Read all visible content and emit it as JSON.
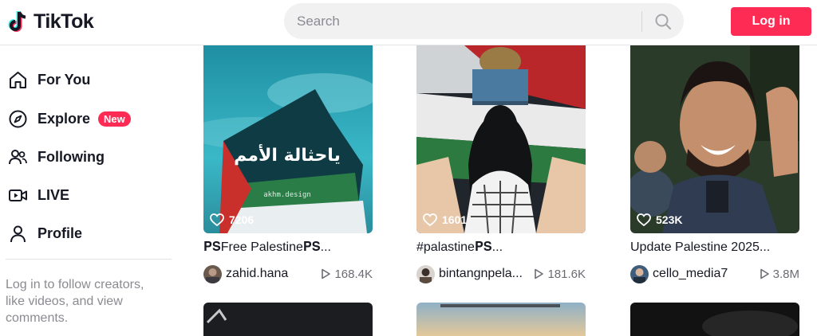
{
  "header": {
    "logo_text": "TikTok",
    "search_placeholder": "Search",
    "login_label": "Log in"
  },
  "sidebar": {
    "items": [
      {
        "label": "For You",
        "icon": "home-icon"
      },
      {
        "label": "Explore",
        "icon": "compass-icon",
        "badge": "New"
      },
      {
        "label": "Following",
        "icon": "users-icon"
      },
      {
        "label": "LIVE",
        "icon": "live-camera-icon"
      },
      {
        "label": "Profile",
        "icon": "profile-icon"
      }
    ],
    "login_prompt": "Log in to follow creators, like videos, and view comments."
  },
  "videos": [
    {
      "likes": "7206",
      "title": "𝐏𝐒Free Palestine𝐏𝐒...",
      "author": "zahid.hana",
      "views": "168.4K",
      "overlay_text": "ياحثالة الأمم",
      "watermark": "akhm.design"
    },
    {
      "likes": "1601",
      "title": "#palastine𝐏𝐒...",
      "author": "bintangnpela...",
      "views": "181.6K"
    },
    {
      "likes": "523K",
      "title": "Update Palestine 2025...",
      "author": "cello_media7",
      "views": "3.8M"
    }
  ],
  "colors": {
    "brand": "#fe2c55",
    "text": "#161823",
    "muted": "#8a8b91",
    "search_bg": "#f1f1f2"
  }
}
